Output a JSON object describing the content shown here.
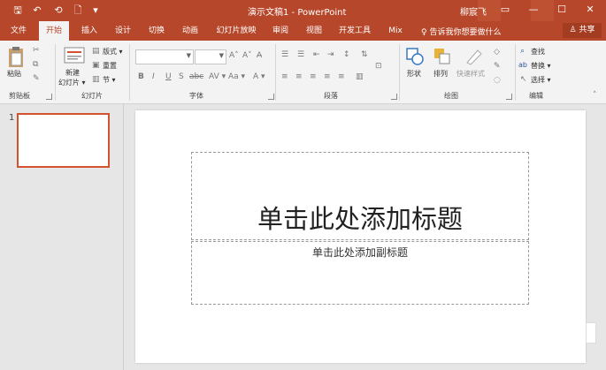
{
  "titlebar": {
    "title": "演示文稿1  -  PowerPoint",
    "user": "柳宸飞",
    "qa_save": "🖫",
    "qa_undo": "↶",
    "qa_redo": "⟲",
    "qa_new": "🗋",
    "qa_more": "▾",
    "win_opts": "▭",
    "win_min": "—",
    "win_max": "☐",
    "win_close": "✕"
  },
  "tabs": [
    "文件",
    "开始",
    "插入",
    "设计",
    "切换",
    "动画",
    "幻灯片放映",
    "审阅",
    "视图",
    "开发工具",
    "Mix"
  ],
  "tell_me": "♀ 告诉我你想要做什么",
  "share": "♙ 共享",
  "ribbon": {
    "clipboard": {
      "label": "剪贴板",
      "paste": "粘贴"
    },
    "slides": {
      "label": "幻灯片",
      "new_slide": "新建",
      "new_slide2": "幻灯片 ▾",
      "layout": "版式 ▾",
      "reset": "重置",
      "section": "节 ▾"
    },
    "font": {
      "label": "字体",
      "B": "B",
      "I": "I",
      "U": "U",
      "S": "S",
      "abc": "abc",
      "AV": "AV ▾",
      "Aa": "Aa ▾",
      "grow": "A˄",
      "shrink": "A˅",
      "clear": "A̶",
      "color": "A ▾"
    },
    "paragraph": {
      "label": "段落"
    },
    "drawing": {
      "label": "绘图",
      "shapes": "形状",
      "arrange": "排列",
      "quick_styles": "快速样式"
    },
    "editing": {
      "label": "编辑",
      "find": "查找",
      "replace": "替换 ▾",
      "select": "选择 ▾"
    }
  },
  "thumbnails": {
    "slide_number": "1"
  },
  "slide": {
    "title_placeholder": "单击此处添加标题",
    "subtitle_placeholder": "单击此处添加副标题"
  },
  "colors": {
    "accent": "#b7472a",
    "thumb_border": "#d35230"
  }
}
